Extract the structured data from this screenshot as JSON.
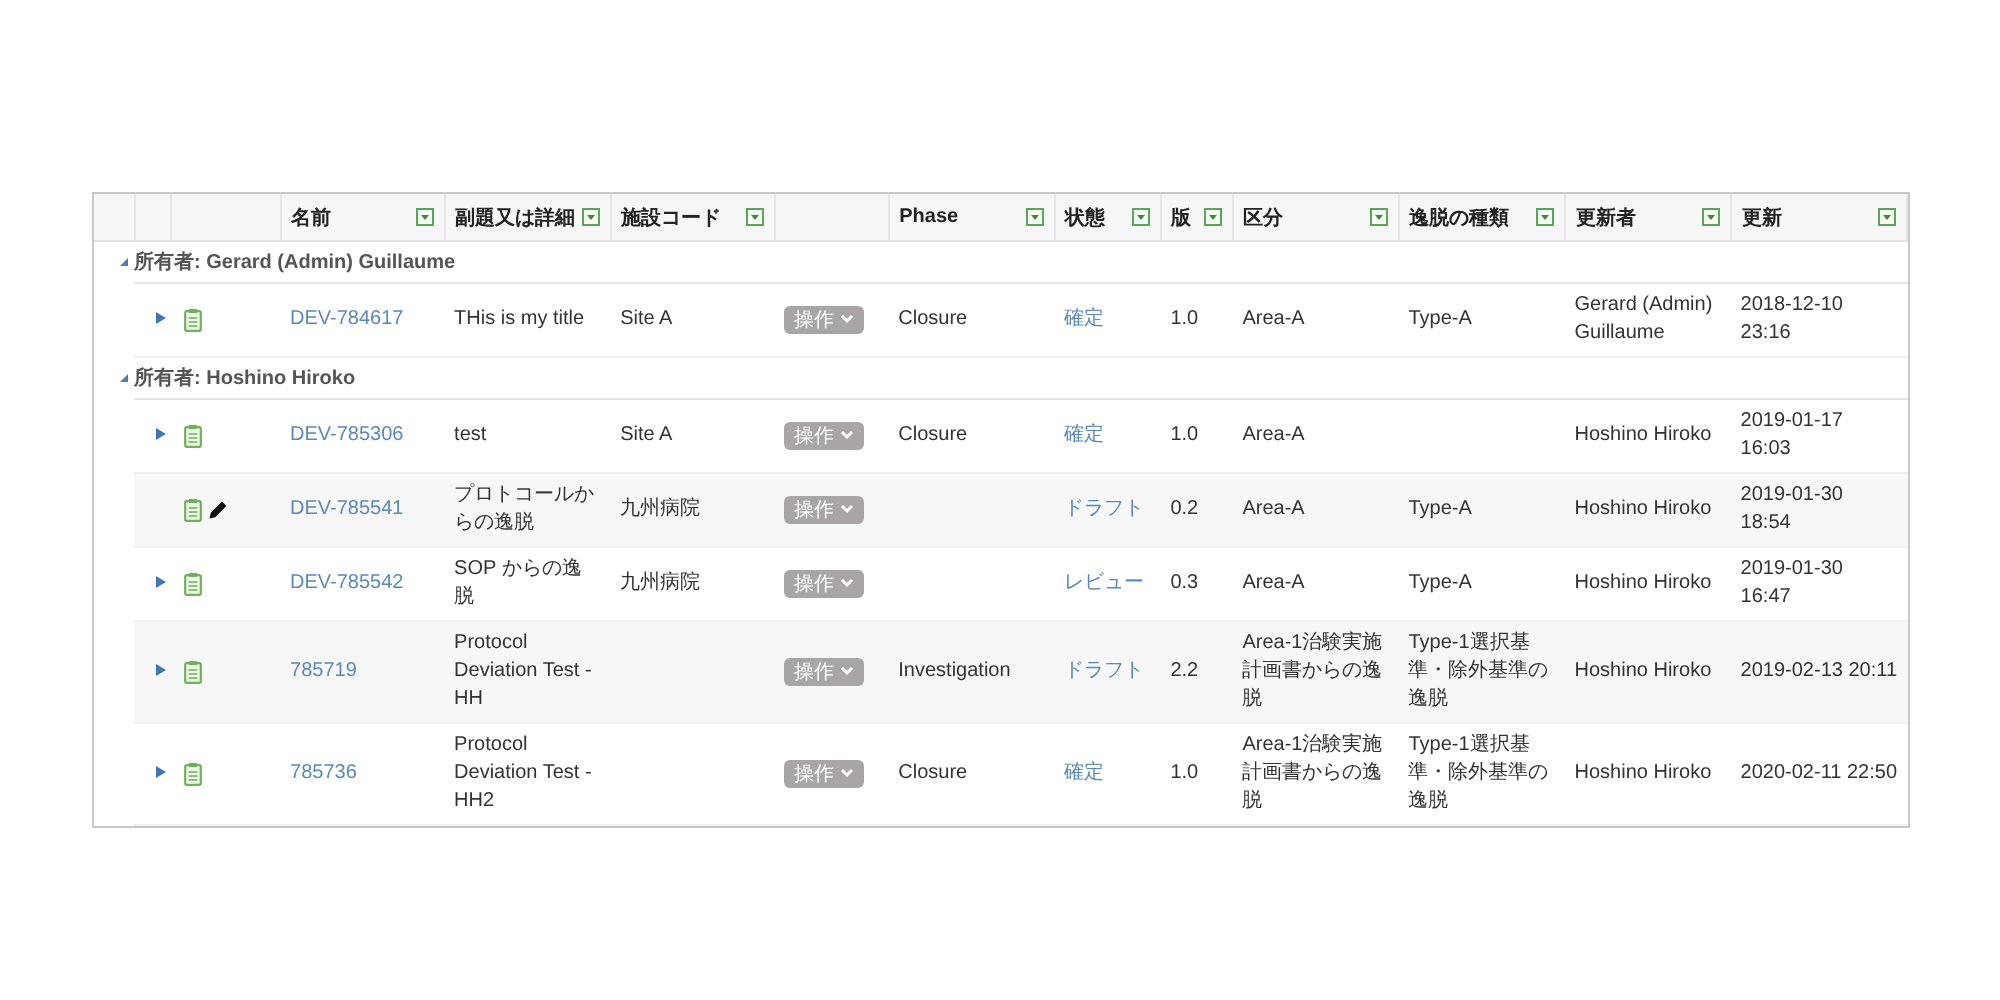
{
  "table": {
    "columns": [
      {
        "label": "名前",
        "filter": true
      },
      {
        "label": "副題又は詳細",
        "filter": true
      },
      {
        "label": "施設コード",
        "filter": true
      },
      {
        "filter": false
      },
      {
        "label": "Phase",
        "filter": true
      },
      {
        "label": "状態",
        "filter": true
      },
      {
        "label": "版",
        "filter": true
      },
      {
        "label": "区分",
        "filter": true
      },
      {
        "label": "逸脱の種類",
        "filter": true
      },
      {
        "label": "更新者",
        "filter": true
      },
      {
        "label": "更新",
        "filter": true
      }
    ],
    "groups": [
      {
        "label": "所有者: Gerard (Admin) Guillaume",
        "expanded": true,
        "rows": [
          {
            "expandable": true,
            "editable": false,
            "name": "DEV-784617",
            "title": "THis is my title",
            "site": "Site A",
            "action": "操作",
            "phase": "Closure",
            "status": "確定",
            "version": "1.0",
            "area": "Area-A",
            "type": "Type-A",
            "updated_by": "Gerard (Admin) Guillaume",
            "updated": "2018-12-10 23:16"
          }
        ]
      },
      {
        "label": "所有者: Hoshino Hiroko",
        "expanded": true,
        "rows": [
          {
            "expandable": true,
            "editable": false,
            "name": "DEV-785306",
            "title": "test",
            "site": "Site A",
            "action": "操作",
            "phase": "Closure",
            "status": "確定",
            "version": "1.0",
            "area": "Area-A",
            "updated_by": "Hoshino Hiroko",
            "updated": "2019-01-17 16:03"
          },
          {
            "expandable": false,
            "editable": true,
            "name": "DEV-785541",
            "title": "プロトコールからの逸脱",
            "site": "九州病院",
            "action": "操作",
            "status": "ドラフト",
            "version": "0.2",
            "area": "Area-A",
            "type": "Type-A",
            "updated_by": "Hoshino Hiroko",
            "updated": "2019-01-30 18:54"
          },
          {
            "expandable": true,
            "editable": false,
            "name": "DEV-785542",
            "title": "SOP からの逸脱",
            "site": "九州病院",
            "action": "操作",
            "status": "レビュー",
            "version": "0.3",
            "area": "Area-A",
            "type": "Type-A",
            "updated_by": "Hoshino Hiroko",
            "updated": "2019-01-30 16:47"
          },
          {
            "expandable": true,
            "editable": false,
            "name": "785719",
            "title": "Protocol Deviation Test - HH",
            "action": "操作",
            "phase": "Investigation",
            "status": "ドラフト",
            "version": "2.2",
            "area": "Area-1治験実施計画書からの逸脱",
            "type": "Type-1選択基準・除外基準の逸脱",
            "updated_by": "Hoshino Hiroko",
            "updated": "2019-02-13 20:11"
          },
          {
            "expandable": true,
            "editable": false,
            "name": "785736",
            "title": "Protocol Deviation Test - HH2",
            "action": "操作",
            "phase": "Closure",
            "status": "確定",
            "version": "1.0",
            "area": "Area-1治験実施計画書からの逸脱",
            "type": "Type-1選択基準・除外基準の逸脱",
            "updated_by": "Hoshino Hiroko",
            "updated": "2020-02-11 22:50"
          }
        ]
      }
    ]
  }
}
